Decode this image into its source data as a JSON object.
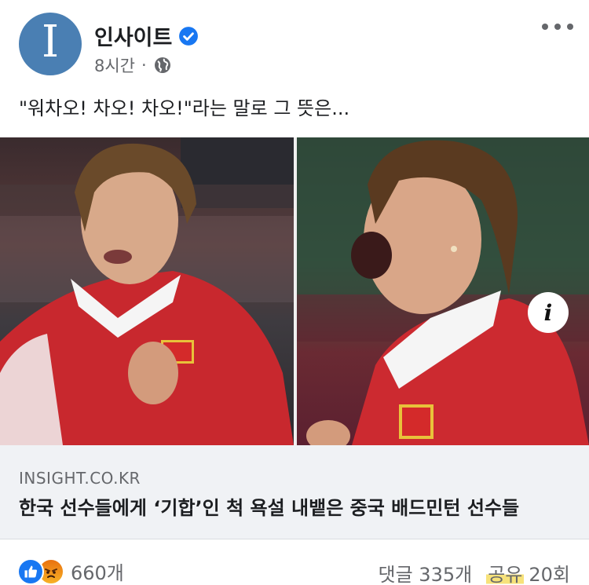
{
  "header": {
    "avatar_letter": "I",
    "page_name": "인사이트",
    "time": "8시간",
    "dot": "·"
  },
  "post": {
    "text": "\"워차오! 차오! 차오!\"라는 말로 그 뜻은..."
  },
  "media": {
    "info_label": "i"
  },
  "link": {
    "domain": "INSIGHT.CO.KR",
    "title": "한국 선수들에게 ‘기합’인 척 욕설 내뱉은 중국 배드민턴 선수들"
  },
  "footer": {
    "reaction_count": "660개",
    "comments": "댓글 335개",
    "share_label": "공유",
    "share_count": "20회"
  },
  "colors": {
    "avatar": "#4a7fb3",
    "verified": "#1877f2",
    "link_bg": "#f0f2f5",
    "share_highlight": "#f7e27a"
  },
  "icons": [
    "verified-badge-icon",
    "globe-icon",
    "more-icon",
    "info-icon",
    "like-reaction-icon",
    "angry-reaction-icon"
  ]
}
